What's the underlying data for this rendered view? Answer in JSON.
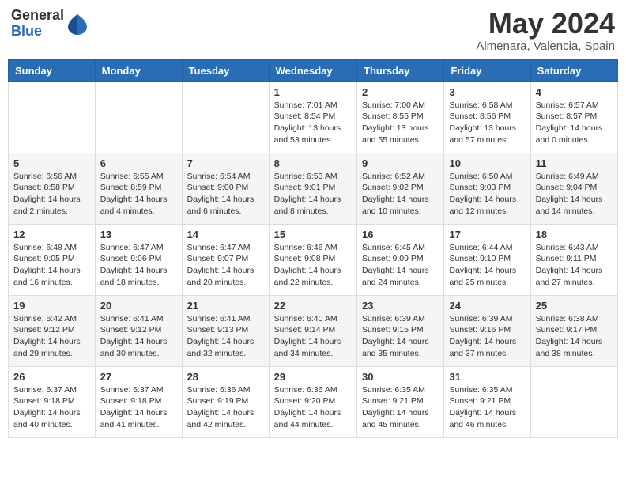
{
  "logo": {
    "general": "General",
    "blue": "Blue"
  },
  "title": "May 2024",
  "location": "Almenara, Valencia, Spain",
  "days_of_week": [
    "Sunday",
    "Monday",
    "Tuesday",
    "Wednesday",
    "Thursday",
    "Friday",
    "Saturday"
  ],
  "weeks": [
    [
      {
        "day": "",
        "info": ""
      },
      {
        "day": "",
        "info": ""
      },
      {
        "day": "",
        "info": ""
      },
      {
        "day": "1",
        "info": "Sunrise: 7:01 AM\nSunset: 8:54 PM\nDaylight: 13 hours\nand 53 minutes."
      },
      {
        "day": "2",
        "info": "Sunrise: 7:00 AM\nSunset: 8:55 PM\nDaylight: 13 hours\nand 55 minutes."
      },
      {
        "day": "3",
        "info": "Sunrise: 6:58 AM\nSunset: 8:56 PM\nDaylight: 13 hours\nand 57 minutes."
      },
      {
        "day": "4",
        "info": "Sunrise: 6:57 AM\nSunset: 8:57 PM\nDaylight: 14 hours\nand 0 minutes."
      }
    ],
    [
      {
        "day": "5",
        "info": "Sunrise: 6:56 AM\nSunset: 8:58 PM\nDaylight: 14 hours\nand 2 minutes."
      },
      {
        "day": "6",
        "info": "Sunrise: 6:55 AM\nSunset: 8:59 PM\nDaylight: 14 hours\nand 4 minutes."
      },
      {
        "day": "7",
        "info": "Sunrise: 6:54 AM\nSunset: 9:00 PM\nDaylight: 14 hours\nand 6 minutes."
      },
      {
        "day": "8",
        "info": "Sunrise: 6:53 AM\nSunset: 9:01 PM\nDaylight: 14 hours\nand 8 minutes."
      },
      {
        "day": "9",
        "info": "Sunrise: 6:52 AM\nSunset: 9:02 PM\nDaylight: 14 hours\nand 10 minutes."
      },
      {
        "day": "10",
        "info": "Sunrise: 6:50 AM\nSunset: 9:03 PM\nDaylight: 14 hours\nand 12 minutes."
      },
      {
        "day": "11",
        "info": "Sunrise: 6:49 AM\nSunset: 9:04 PM\nDaylight: 14 hours\nand 14 minutes."
      }
    ],
    [
      {
        "day": "12",
        "info": "Sunrise: 6:48 AM\nSunset: 9:05 PM\nDaylight: 14 hours\nand 16 minutes."
      },
      {
        "day": "13",
        "info": "Sunrise: 6:47 AM\nSunset: 9:06 PM\nDaylight: 14 hours\nand 18 minutes."
      },
      {
        "day": "14",
        "info": "Sunrise: 6:47 AM\nSunset: 9:07 PM\nDaylight: 14 hours\nand 20 minutes."
      },
      {
        "day": "15",
        "info": "Sunrise: 6:46 AM\nSunset: 9:08 PM\nDaylight: 14 hours\nand 22 minutes."
      },
      {
        "day": "16",
        "info": "Sunrise: 6:45 AM\nSunset: 9:09 PM\nDaylight: 14 hours\nand 24 minutes."
      },
      {
        "day": "17",
        "info": "Sunrise: 6:44 AM\nSunset: 9:10 PM\nDaylight: 14 hours\nand 25 minutes."
      },
      {
        "day": "18",
        "info": "Sunrise: 6:43 AM\nSunset: 9:11 PM\nDaylight: 14 hours\nand 27 minutes."
      }
    ],
    [
      {
        "day": "19",
        "info": "Sunrise: 6:42 AM\nSunset: 9:12 PM\nDaylight: 14 hours\nand 29 minutes."
      },
      {
        "day": "20",
        "info": "Sunrise: 6:41 AM\nSunset: 9:12 PM\nDaylight: 14 hours\nand 30 minutes."
      },
      {
        "day": "21",
        "info": "Sunrise: 6:41 AM\nSunset: 9:13 PM\nDaylight: 14 hours\nand 32 minutes."
      },
      {
        "day": "22",
        "info": "Sunrise: 6:40 AM\nSunset: 9:14 PM\nDaylight: 14 hours\nand 34 minutes."
      },
      {
        "day": "23",
        "info": "Sunrise: 6:39 AM\nSunset: 9:15 PM\nDaylight: 14 hours\nand 35 minutes."
      },
      {
        "day": "24",
        "info": "Sunrise: 6:39 AM\nSunset: 9:16 PM\nDaylight: 14 hours\nand 37 minutes."
      },
      {
        "day": "25",
        "info": "Sunrise: 6:38 AM\nSunset: 9:17 PM\nDaylight: 14 hours\nand 38 minutes."
      }
    ],
    [
      {
        "day": "26",
        "info": "Sunrise: 6:37 AM\nSunset: 9:18 PM\nDaylight: 14 hours\nand 40 minutes."
      },
      {
        "day": "27",
        "info": "Sunrise: 6:37 AM\nSunset: 9:18 PM\nDaylight: 14 hours\nand 41 minutes."
      },
      {
        "day": "28",
        "info": "Sunrise: 6:36 AM\nSunset: 9:19 PM\nDaylight: 14 hours\nand 42 minutes."
      },
      {
        "day": "29",
        "info": "Sunrise: 6:36 AM\nSunset: 9:20 PM\nDaylight: 14 hours\nand 44 minutes."
      },
      {
        "day": "30",
        "info": "Sunrise: 6:35 AM\nSunset: 9:21 PM\nDaylight: 14 hours\nand 45 minutes."
      },
      {
        "day": "31",
        "info": "Sunrise: 6:35 AM\nSunset: 9:21 PM\nDaylight: 14 hours\nand 46 minutes."
      },
      {
        "day": "",
        "info": ""
      }
    ]
  ]
}
